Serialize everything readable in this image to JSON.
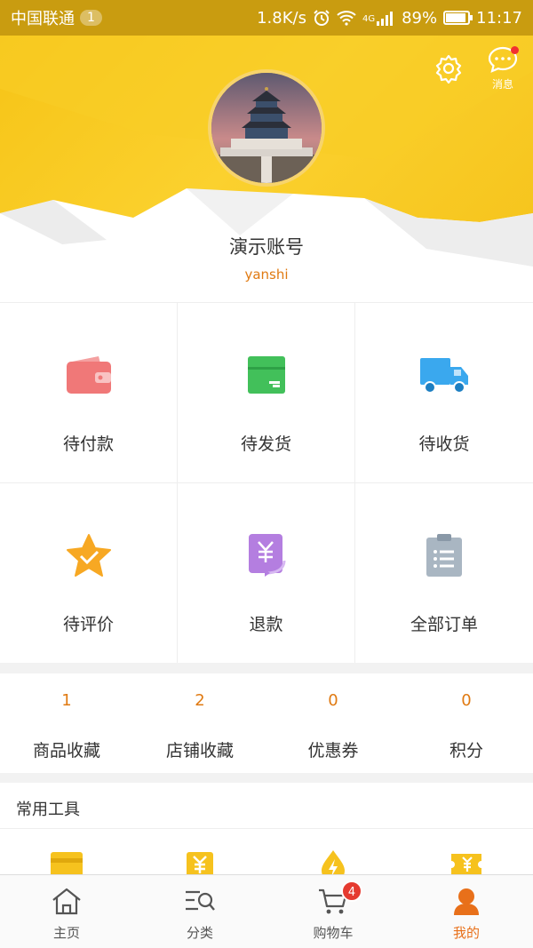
{
  "status_bar": {
    "carrier": "中国联通",
    "carrier_badge": "1",
    "speed": "1.8K/s",
    "network": "4G",
    "battery": "89%",
    "time": "11:17"
  },
  "header": {
    "messages_label": "消息",
    "username": "演示账号",
    "account": "yanshi"
  },
  "orders": [
    {
      "label": "待付款",
      "icon": "wallet-icon"
    },
    {
      "label": "待发货",
      "icon": "package-icon"
    },
    {
      "label": "待收货",
      "icon": "truck-icon"
    },
    {
      "label": "待评价",
      "icon": "star-icon"
    },
    {
      "label": "退款",
      "icon": "refund-icon"
    },
    {
      "label": "全部订单",
      "icon": "clipboard-icon"
    }
  ],
  "stats": [
    {
      "count": "1",
      "label": "商品收藏"
    },
    {
      "count": "2",
      "label": "店铺收藏"
    },
    {
      "count": "0",
      "label": "优惠券"
    },
    {
      "count": "0",
      "label": "积分"
    }
  ],
  "tools": {
    "title": "常用工具"
  },
  "tabs": [
    {
      "label": "主页",
      "icon": "home-icon"
    },
    {
      "label": "分类",
      "icon": "category-search-icon"
    },
    {
      "label": "购物车",
      "icon": "cart-icon",
      "badge": "4"
    },
    {
      "label": "我的",
      "icon": "user-icon",
      "active": true
    }
  ],
  "colors": {
    "brand_yellow": "#f6c417",
    "accent_orange": "#e07a12",
    "badge_red": "#e53a2f"
  }
}
